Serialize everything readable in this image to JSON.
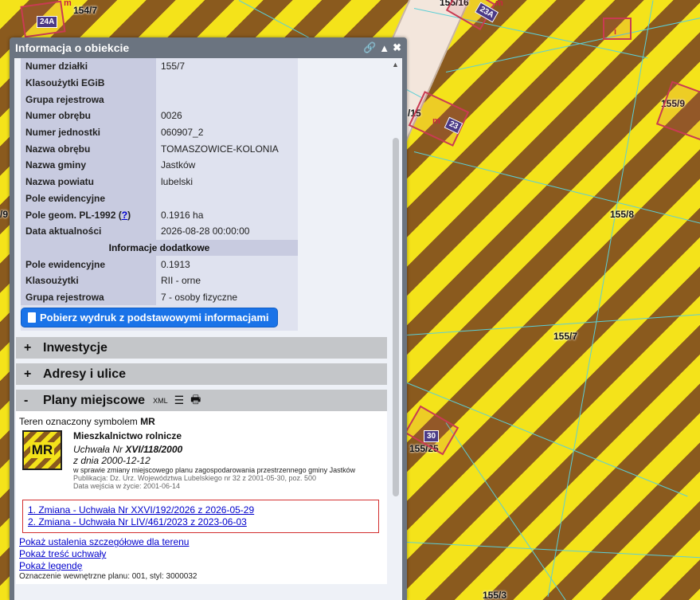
{
  "panel": {
    "title": "Informacja o obiekcie"
  },
  "attributes": [
    {
      "key": "Numer działki",
      "value": "155/7"
    },
    {
      "key": "Klasoużytki EGiB",
      "value": ""
    },
    {
      "key": "Grupa rejestrowa",
      "value": ""
    },
    {
      "key": "Numer obrębu",
      "value": "0026"
    },
    {
      "key": "Numer jednostki",
      "value": "060907_2"
    },
    {
      "key": "Nazwa obrębu",
      "value": "TOMASZOWICE-KOLONIA"
    },
    {
      "key": "Nazwa gminy",
      "value": "Jastków"
    },
    {
      "key": "Nazwa powiatu",
      "value": "lubelski"
    },
    {
      "key": "Pole ewidencyjne",
      "value": ""
    },
    {
      "key": "Pole geom. PL-1992",
      "help": "?",
      "value": "0.1916 ha"
    },
    {
      "key": "Data aktualności",
      "value": "2026-08-28 00:00:00"
    }
  ],
  "extra_section_title": "Informacje dodatkowe",
  "extra_attributes": [
    {
      "key": "Pole ewidencyjne",
      "value": "0.1913"
    },
    {
      "key": "Klasoużytki",
      "value": "RII - orne"
    },
    {
      "key": "Grupa rejestrowa",
      "value": "7 - osoby fizyczne"
    }
  ],
  "print_button": "Pobierz wydruk z podstawowymi informacjami",
  "sections": {
    "inwestycje": {
      "sign": "+",
      "label": "Inwestycje"
    },
    "adresy": {
      "sign": "+",
      "label": "Adresy i ulice"
    },
    "plany": {
      "sign": "-",
      "label": "Plany miejscowe",
      "xml": "XML"
    }
  },
  "plan": {
    "intro_prefix": "Teren oznaczony symbolem",
    "symbol": "MR",
    "symbol_label": "MR",
    "name": "Mieszkalnictwo rolnicze",
    "uchwala_prefix": "Uchwała Nr",
    "uchwala_nr": "XVI/118/2000",
    "date_line": "z dnia 2000-12-12",
    "description": "w sprawie zmiany miejscowego planu zagospodarowania przestrzennego gminy Jastków",
    "publication": "Publikacja: Dz. Urz. Województwa Lubelskiego nr 32 z 2001-05-30, poz. 500",
    "effective": "Data wejścia w życie: 2001-06-14",
    "changes": [
      "1. Zmiana - Uchwała Nr XXVI/192/2026 z 2026-05-29",
      "2. Zmiana - Uchwała Nr LIV/461/2023 z 2023-06-03"
    ],
    "links": [
      "Pokaż ustalenia szczegółowe dla terenu",
      "Pokaż treść uchwały",
      "Pokaż legendę"
    ],
    "footer": "Oznaczenie wewnętrzne planu: 001, styl: 3000032"
  },
  "map": {
    "parcel_labels": [
      "154/7",
      "155/16",
      "155/9",
      "/15",
      "155/8",
      "155/7",
      "155/25",
      "155/3",
      "/9"
    ],
    "building_tags": [
      "24A",
      "23A",
      "23",
      "30"
    ]
  }
}
